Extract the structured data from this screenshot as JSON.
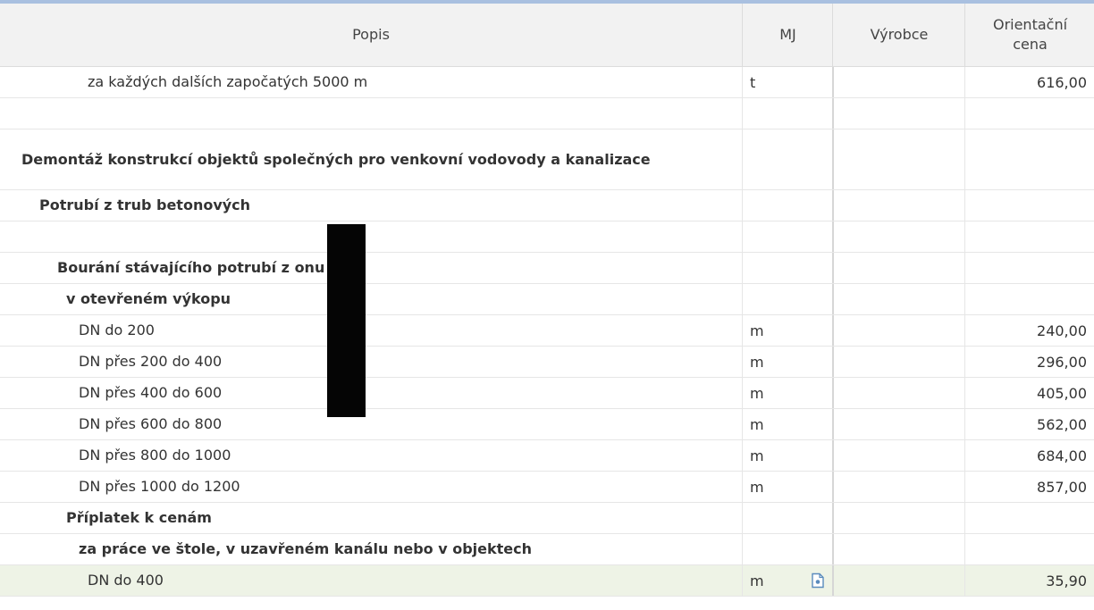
{
  "header": {
    "popis": "Popis",
    "mj": "MJ",
    "vyrobce": "Výrobce",
    "cena_line1": "Orientační",
    "cena_line2": "cena"
  },
  "rows": [
    {
      "popis": "za každých dalších započatých 5000 m",
      "mj": "t",
      "vyrobce": "",
      "cena": "616,00"
    },
    {
      "popis": "",
      "mj": "",
      "vyrobce": "",
      "cena": ""
    },
    {
      "popis": "Demontáž konstrukcí objektů společných pro venkovní vodovody a kanalizace",
      "mj": "",
      "vyrobce": "",
      "cena": ""
    },
    {
      "popis": "Potrubí z trub betonových",
      "mj": "",
      "vyrobce": "",
      "cena": ""
    },
    {
      "popis": "",
      "mj": "",
      "vyrobce": "",
      "cena": ""
    },
    {
      "popis": "Bourání stávajícího potrubí z onu",
      "mj": "",
      "vyrobce": "",
      "cena": ""
    },
    {
      "popis": "v otevřeném výkopu",
      "mj": "",
      "vyrobce": "",
      "cena": ""
    },
    {
      "popis": "DN do 200",
      "mj": "m",
      "vyrobce": "",
      "cena": "240,00"
    },
    {
      "popis": "DN přes 200 do 400",
      "mj": "m",
      "vyrobce": "",
      "cena": "296,00"
    },
    {
      "popis": "DN přes 400 do 600",
      "mj": "m",
      "vyrobce": "",
      "cena": "405,00"
    },
    {
      "popis": "DN přes 600 do 800",
      "mj": "m",
      "vyrobce": "",
      "cena": "562,00"
    },
    {
      "popis": "DN přes 800 do 1000",
      "mj": "m",
      "vyrobce": "",
      "cena": "684,00"
    },
    {
      "popis": "DN přes 1000 do 1200",
      "mj": "m",
      "vyrobce": "",
      "cena": "857,00"
    },
    {
      "popis": "Příplatek k cenám",
      "mj": "",
      "vyrobce": "",
      "cena": ""
    },
    {
      "popis": "za práce ve štole, v uzavřeném kanálu nebo v objektech",
      "mj": "",
      "vyrobce": "",
      "cena": ""
    },
    {
      "popis": "DN do 400",
      "mj": "m",
      "vyrobce": "",
      "cena": "35,90"
    }
  ],
  "icons": {
    "detail": "document-icon"
  },
  "colors": {
    "header_bg": "#f2f2f2",
    "selected_row_bg": "#eef3e6",
    "top_bar": "#a9c0e0",
    "icon_accent": "#5a8bbd"
  }
}
